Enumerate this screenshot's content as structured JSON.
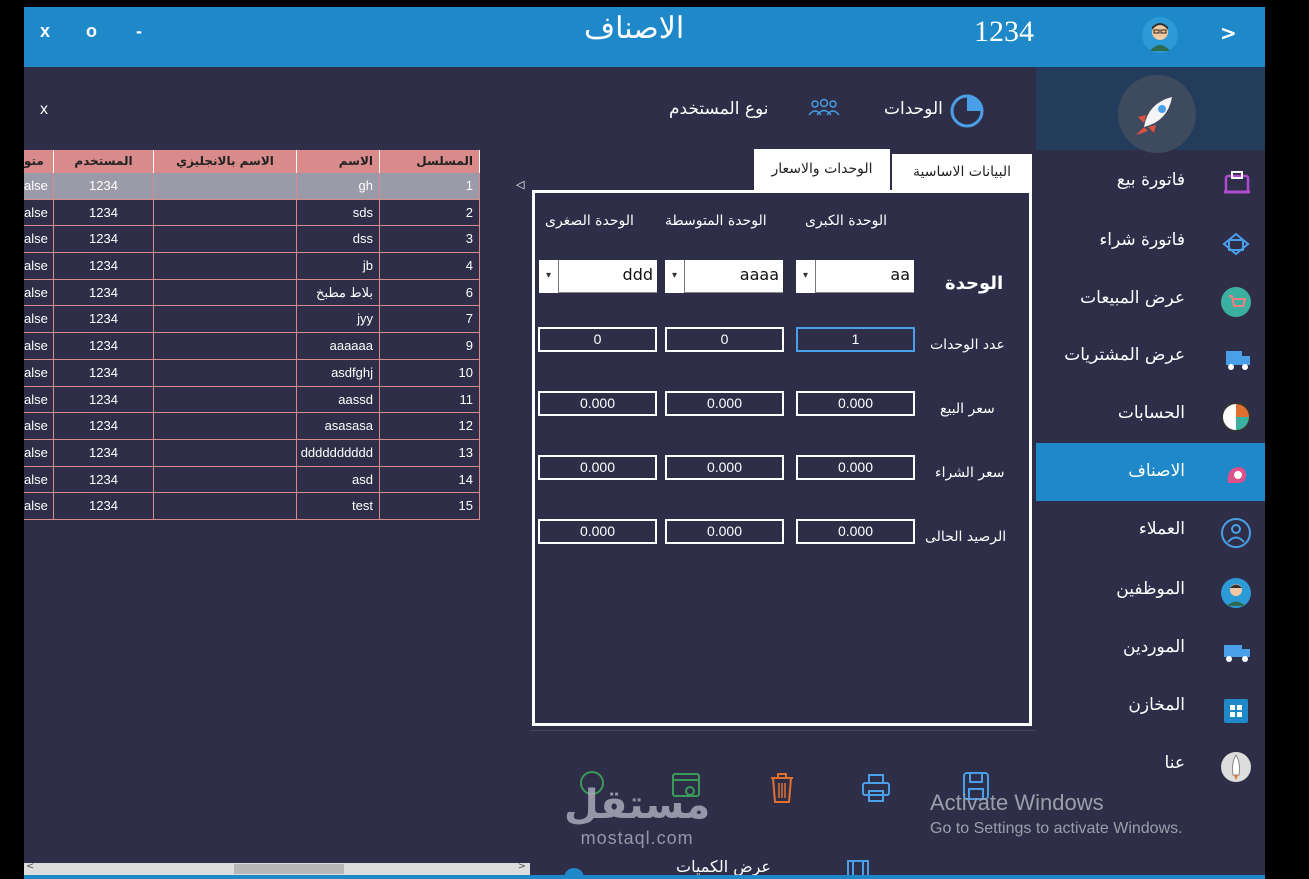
{
  "titlebar": {
    "close": "x",
    "maximize": "o",
    "minimize": "-",
    "title": "الاصناف",
    "code": "1234",
    "next": ">"
  },
  "header": {
    "close": "x",
    "units": "الوحدات",
    "user_type": "نوع المستخدم"
  },
  "sidebar": {
    "items": [
      {
        "label": "فاتورة بيع",
        "icon": "cash-register-icon"
      },
      {
        "label": "فاتورة شراء",
        "icon": "card-icon"
      },
      {
        "label": "عرض المبيعات",
        "icon": "cart-icon"
      },
      {
        "label": "عرض المشتريات",
        "icon": "truck-icon"
      },
      {
        "label": "الحسابات",
        "icon": "pie-chart-icon"
      },
      {
        "label": "الاصناف",
        "icon": "items-icon"
      },
      {
        "label": "العملاء",
        "icon": "user-circle-icon"
      },
      {
        "label": "الموظفين",
        "icon": "employee-icon"
      },
      {
        "label": "الموردين",
        "icon": "delivery-truck-icon"
      },
      {
        "label": "المخازن",
        "icon": "store-icon"
      },
      {
        "label": "عنا",
        "icon": "rocket-icon"
      }
    ],
    "active_index": 5
  },
  "table": {
    "columns": [
      "متو",
      "المستخدم",
      "الاسم بالانجليزي",
      "الاسم",
      "المسلسل"
    ],
    "rows": [
      [
        "alse",
        "1234",
        "",
        "gh",
        "1"
      ],
      [
        "alse",
        "1234",
        "",
        "sds",
        "2"
      ],
      [
        "alse",
        "1234",
        "",
        "dss",
        "3"
      ],
      [
        "alse",
        "1234",
        "",
        "jb",
        "4"
      ],
      [
        "alse",
        "1234",
        "",
        "بلاط مطبخ",
        "6"
      ],
      [
        "alse",
        "1234",
        "",
        "jyy",
        "7"
      ],
      [
        "alse",
        "1234",
        "",
        "aaaaaa",
        "9"
      ],
      [
        "alse",
        "1234",
        "",
        "asdfghj",
        "10"
      ],
      [
        "alse",
        "1234",
        "",
        "aassd",
        "11"
      ],
      [
        "alse",
        "1234",
        "",
        "asasasa",
        "12"
      ],
      [
        "alse",
        "1234",
        "",
        "dddddddddd",
        "13"
      ],
      [
        "alse",
        "1234",
        "",
        "asd",
        "14"
      ],
      [
        "alse",
        "1234",
        "",
        "test",
        "15"
      ]
    ],
    "selected_index": 0
  },
  "tabs": {
    "basic": "البيانات الاساسية",
    "units_prices": "الوحدات والاسعار"
  },
  "units_panel": {
    "col_large": "الوحدة الكبرى",
    "col_medium": "الوحدة المتوسطة",
    "col_small": "الوحدة الصغرى",
    "unit_label": "الوحدة",
    "unit_large": "aa",
    "unit_medium": "aaaa",
    "unit_small": "ddd",
    "combo_arrow": "▾",
    "rows": [
      {
        "label": "عدد الوحدات",
        "large": "1",
        "medium": "0",
        "small": "0"
      },
      {
        "label": "سعر البيع",
        "large": "0.000",
        "medium": "0.000",
        "small": "0.000"
      },
      {
        "label": "سعر الشراء",
        "large": "0.000",
        "medium": "0.000",
        "small": "0.000"
      },
      {
        "label": "الرصيد الحالى",
        "large": "0.000",
        "medium": "0.000",
        "small": "0.000"
      }
    ]
  },
  "bottom": {
    "qty_label": "عرض الكميات"
  },
  "overlay": {
    "activate_title": "Activate Windows",
    "activate_sub": "Go to Settings to activate Windows.",
    "watermark_ar": "مستقل",
    "watermark_en": "mostaql.com"
  },
  "colors": {
    "accent": "#1e88c8",
    "background": "#2e2e48",
    "table_header": "#d98a8a"
  }
}
